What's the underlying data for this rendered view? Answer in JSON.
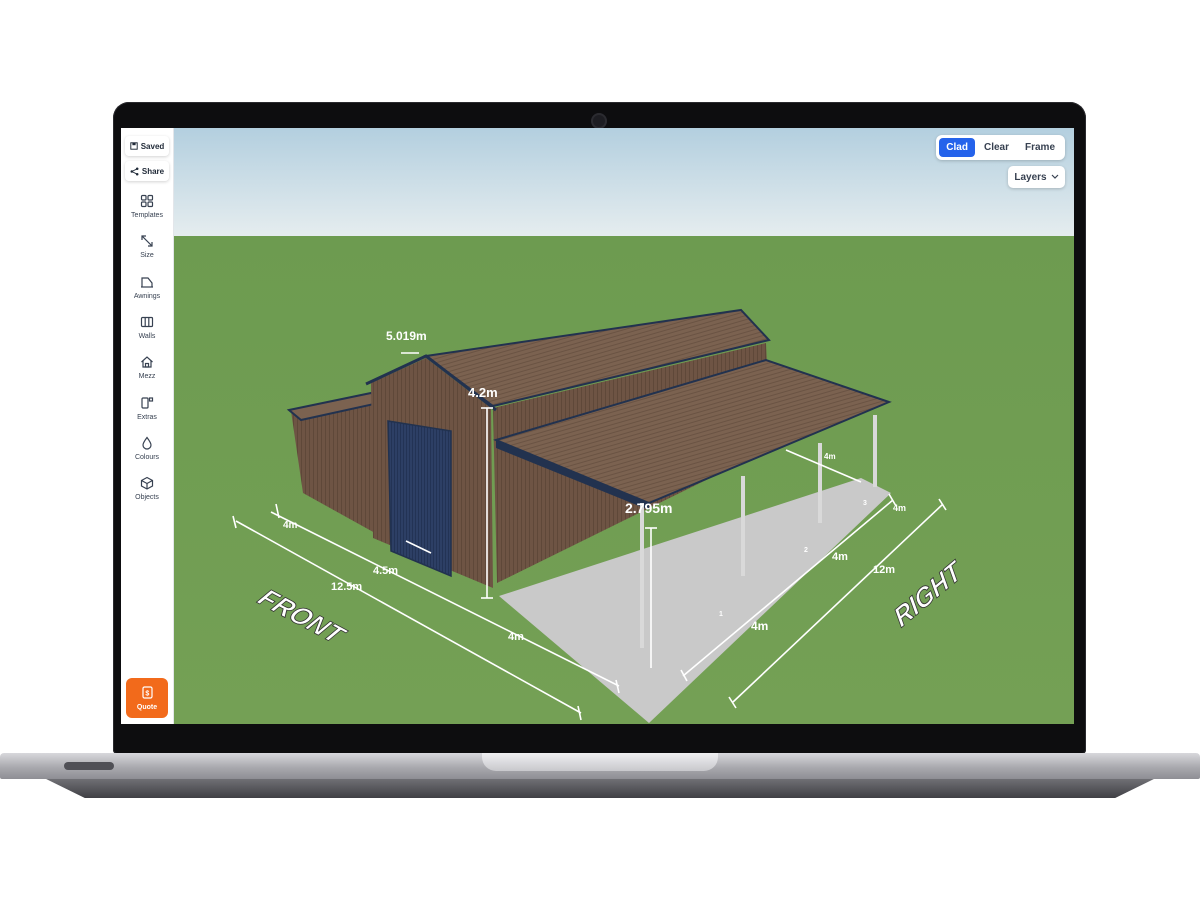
{
  "sidebar": {
    "saved_label": "Saved",
    "share_label": "Share",
    "tools": [
      {
        "label": "Templates",
        "icon": "grid-icon"
      },
      {
        "label": "Size",
        "icon": "resize-icon"
      },
      {
        "label": "Awnings",
        "icon": "awning-icon"
      },
      {
        "label": "Walls",
        "icon": "walls-icon"
      },
      {
        "label": "Mezz",
        "icon": "house-icon"
      },
      {
        "label": "Extras",
        "icon": "extras-icon"
      },
      {
        "label": "Colours",
        "icon": "droplet-icon"
      },
      {
        "label": "Objects",
        "icon": "cube-icon"
      }
    ],
    "quote_label": "Quote"
  },
  "view_toggle": {
    "options": [
      "Clad",
      "Clear",
      "Frame"
    ],
    "selected": "Clad",
    "active_color": "#2563eb"
  },
  "layers": {
    "label": "Layers"
  },
  "scene": {
    "dimensions": {
      "roof_width": "5.019m",
      "wall_height": "4.2m",
      "awning_height": "2.795m",
      "front_segment_a": "4m",
      "front_segment_b": "4.5m",
      "front_total": "12.5m",
      "front_segment_c": "4m",
      "right_segment_a": "4m",
      "right_segment_b": "4m",
      "right_total": "12m",
      "right_segment_c": "4m",
      "rear_awning": "4m",
      "bay_1": "1",
      "bay_2": "2",
      "bay_3": "3"
    },
    "front_label": "FRONT",
    "right_label": "RIGHT",
    "colors": {
      "wall": "#6e5444",
      "roof": "#7a6150",
      "trim": "#22324f",
      "door": "#2c3e63",
      "grass": "#6f9a4f",
      "sky": "#cfe1ea",
      "slab": "#c9c9c9"
    }
  }
}
